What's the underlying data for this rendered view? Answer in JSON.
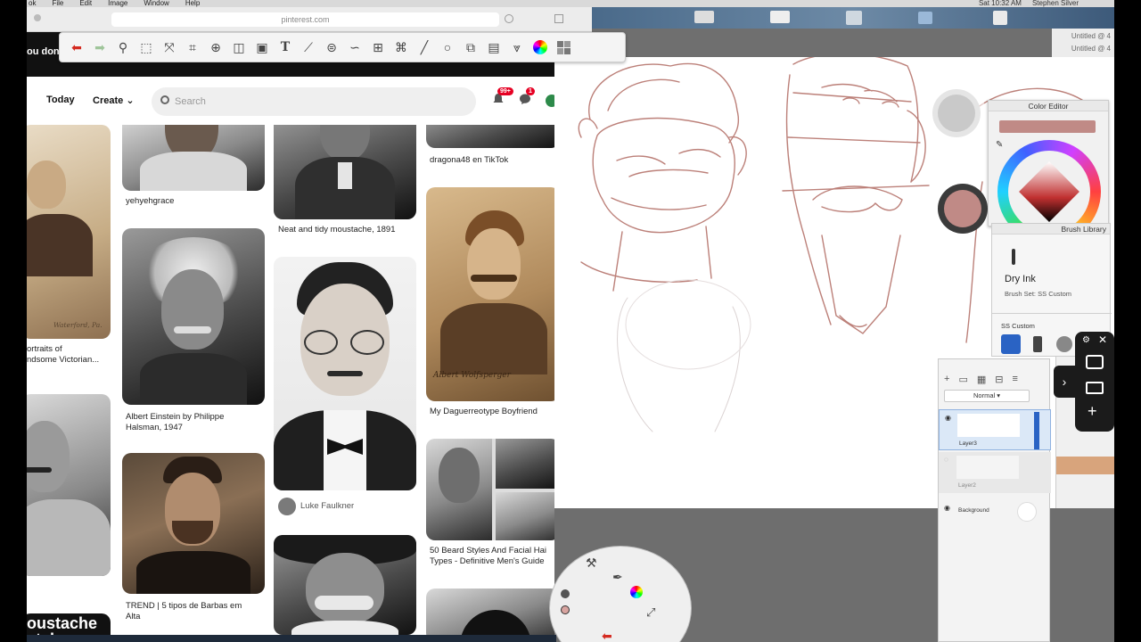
{
  "menubar": {
    "items": [
      "ok",
      "File",
      "Edit",
      "Image",
      "Window",
      "Help"
    ],
    "clock": "Sat 10:32 AM",
    "user": "Stephen Silver"
  },
  "browser": {
    "url": "pinterest.com",
    "promo": "ou don"
  },
  "pinterest": {
    "nav_today": "Today",
    "nav_create": "Create",
    "search_placeholder": "Search",
    "notif_badge": "99+",
    "msg_badge": "1",
    "pins": {
      "col1_a_caption": "ortraits of\nndsome Victorian...",
      "col1_a_inscription": "Waterford, Pa.",
      "col1_b_title": "oustache\nstyles",
      "col2_a_caption": "yehyehgrace",
      "col2_b_caption": "Albert Einstein by Philippe\nHalsman, 1947",
      "col2_c_caption": "TREND | 5 tipos de Barbas em\nAlta",
      "col3_a_caption": "Neat and tidy moustache, 1891",
      "col3_b_author": "Luke Faulkner",
      "col4_a_caption": "dragona48 en TikTok",
      "col4_b_caption": "My Daguerreotype Boyfriend",
      "col4_b_signature": "Albert Wolfsperger",
      "col4_c_caption": "50 Beard Styles And Facial Hai\nTypes - Definitive Men's Guide"
    }
  },
  "sketchbook": {
    "untitled_1": "Untitled @ 4",
    "untitled_2": "Untitled @ 4",
    "color_editor_title": "Color Editor",
    "current_color": "#c08a86",
    "brush_library_title": "Brush Library",
    "brush_name": "Dry Ink",
    "brush_set": "Brush Set: SS Custom",
    "brush_set_label": "SS Custom",
    "blend_mode": "Normal",
    "layers": [
      "Layer3",
      "Layer2",
      "Background"
    ],
    "sketch_color": "#b5736b"
  }
}
